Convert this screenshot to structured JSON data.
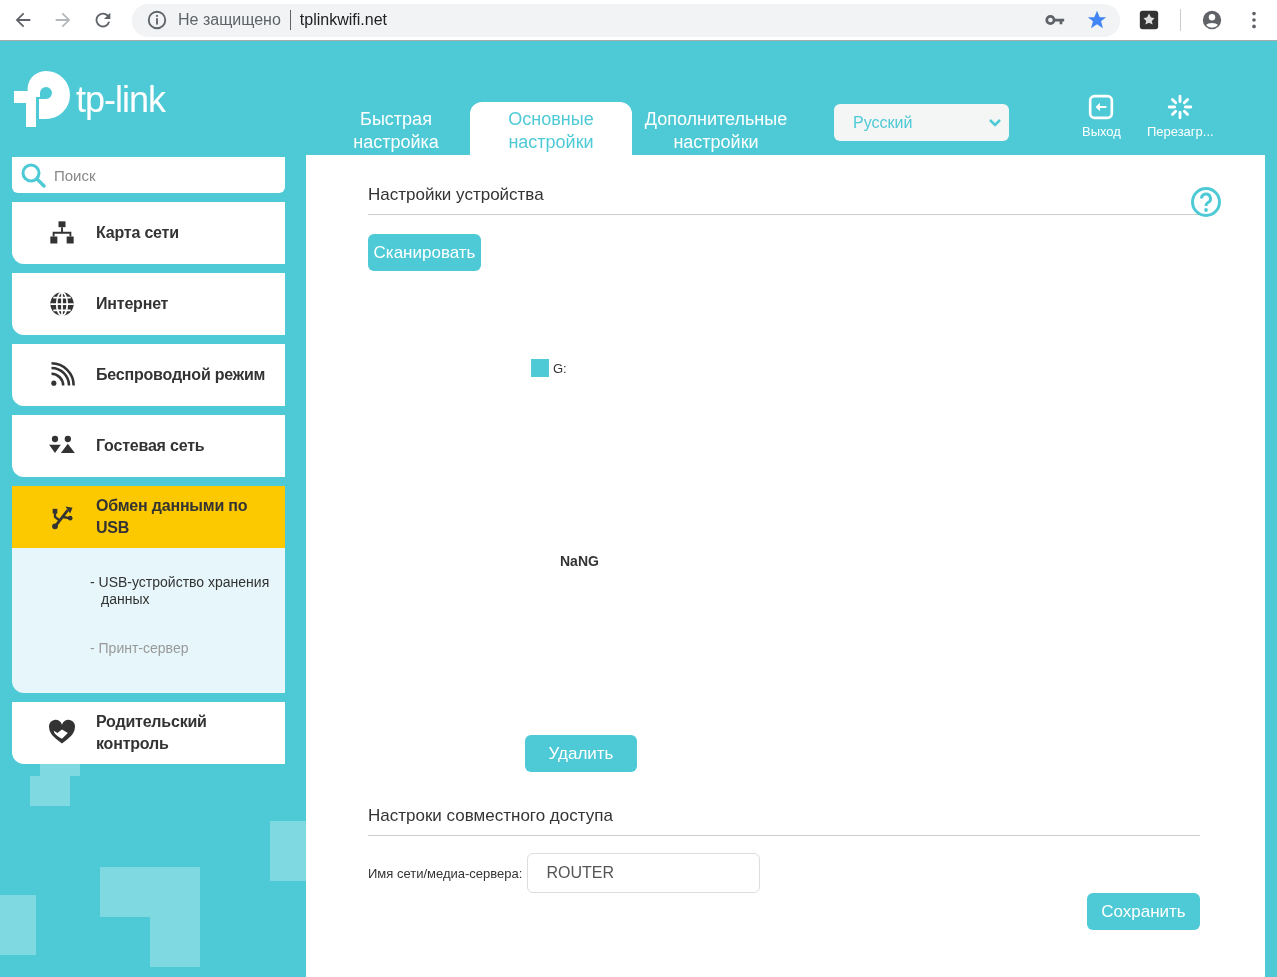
{
  "browser": {
    "security": "Не защищено",
    "url": "tplinkwifi.net",
    "bookmarked": true
  },
  "header": {
    "logo": "tp-link",
    "tabs": [
      {
        "label": "Быстрая настройка",
        "selected": false
      },
      {
        "label": "Основные настройки",
        "selected": true
      },
      {
        "label": "Дополнительные настройки",
        "selected": false
      }
    ],
    "language": "Русский",
    "actions": [
      {
        "kind": "logout",
        "label": "Выход"
      },
      {
        "kind": "reboot",
        "label": "Перезагр..."
      }
    ]
  },
  "sidebar": {
    "search_placeholder": "Поиск",
    "items": [
      {
        "kind": "network-map",
        "label": "Карта сети",
        "selected": false,
        "expanded": false
      },
      {
        "kind": "internet",
        "label": "Интернет",
        "selected": false,
        "expanded": false
      },
      {
        "kind": "wireless",
        "label": "Беспроводной режим",
        "selected": false,
        "expanded": false
      },
      {
        "kind": "guest",
        "label": "Гостевая сеть",
        "selected": false,
        "expanded": false
      },
      {
        "kind": "usb",
        "label": "Обмен данными по USB",
        "selected": true,
        "expanded": true,
        "children": [
          {
            "label": "- USB-устройство хранения данных",
            "selected": true
          },
          {
            "label": "- Принт-сервер",
            "selected": false
          }
        ]
      },
      {
        "kind": "parental",
        "label": "Родительский контроль",
        "selected": false,
        "expanded": false
      }
    ]
  },
  "device_settings": {
    "title": "Настройки устройства",
    "scan_button": "Сканировать",
    "legend": "G:",
    "capacity": "NaNG",
    "delete_button": "Удалить"
  },
  "sharing_settings": {
    "title": "Настроки совместного доступа",
    "field_label": "Имя сети/медиа-сервера:",
    "field_value": "ROUTER",
    "save_button": "Сохранить"
  }
}
